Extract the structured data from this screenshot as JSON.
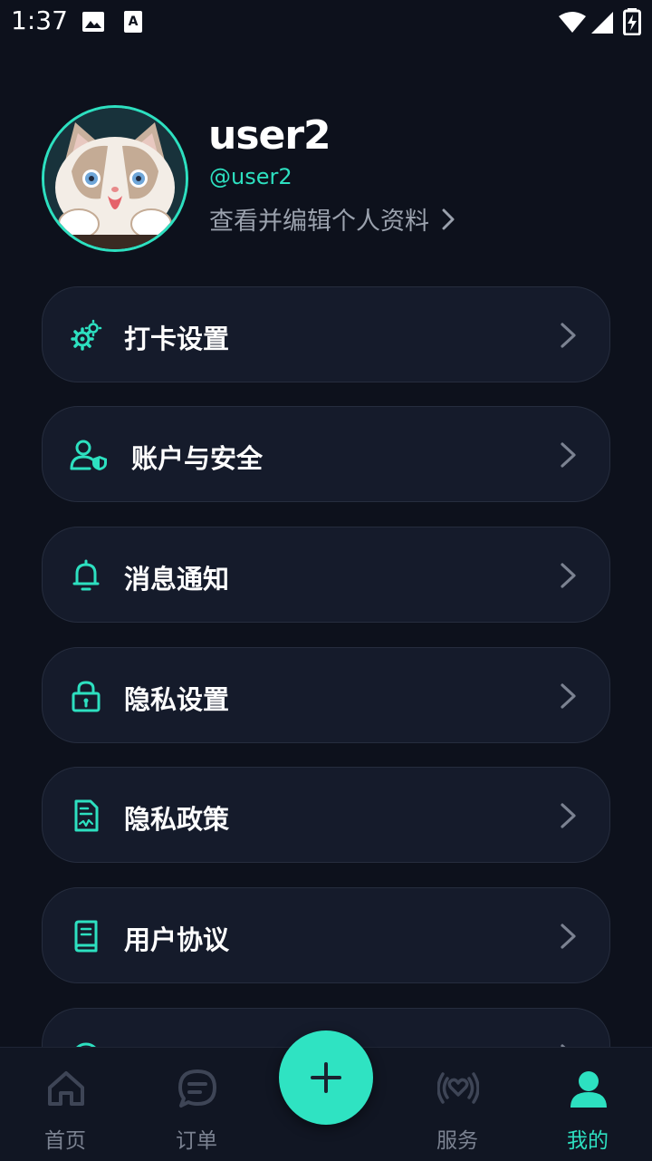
{
  "status_bar": {
    "time": "1:37"
  },
  "profile": {
    "username": "user2",
    "handle": "@user2",
    "edit_link": "查看并编辑个人资料"
  },
  "menu": [
    {
      "label": "打卡设置",
      "icon": "gears-icon"
    },
    {
      "label": "账户与安全",
      "icon": "user-shield-icon"
    },
    {
      "label": "消息通知",
      "icon": "bell-icon"
    },
    {
      "label": "隐私设置",
      "icon": "lock-icon"
    },
    {
      "label": "隐私政策",
      "icon": "document-icon"
    },
    {
      "label": "用户协议",
      "icon": "book-icon"
    }
  ],
  "bottom_nav": {
    "items": [
      {
        "label": "首页",
        "icon": "home-icon"
      },
      {
        "label": "订单",
        "icon": "chat-icon"
      },
      {
        "label": "服务",
        "icon": "broadcast-heart-icon"
      },
      {
        "label": "我的",
        "icon": "person-icon"
      }
    ],
    "active": "我的"
  },
  "colors": {
    "accent": "#2de0c0",
    "background": "#0d111c",
    "card": "#151b2b",
    "muted": "#7b8291"
  }
}
